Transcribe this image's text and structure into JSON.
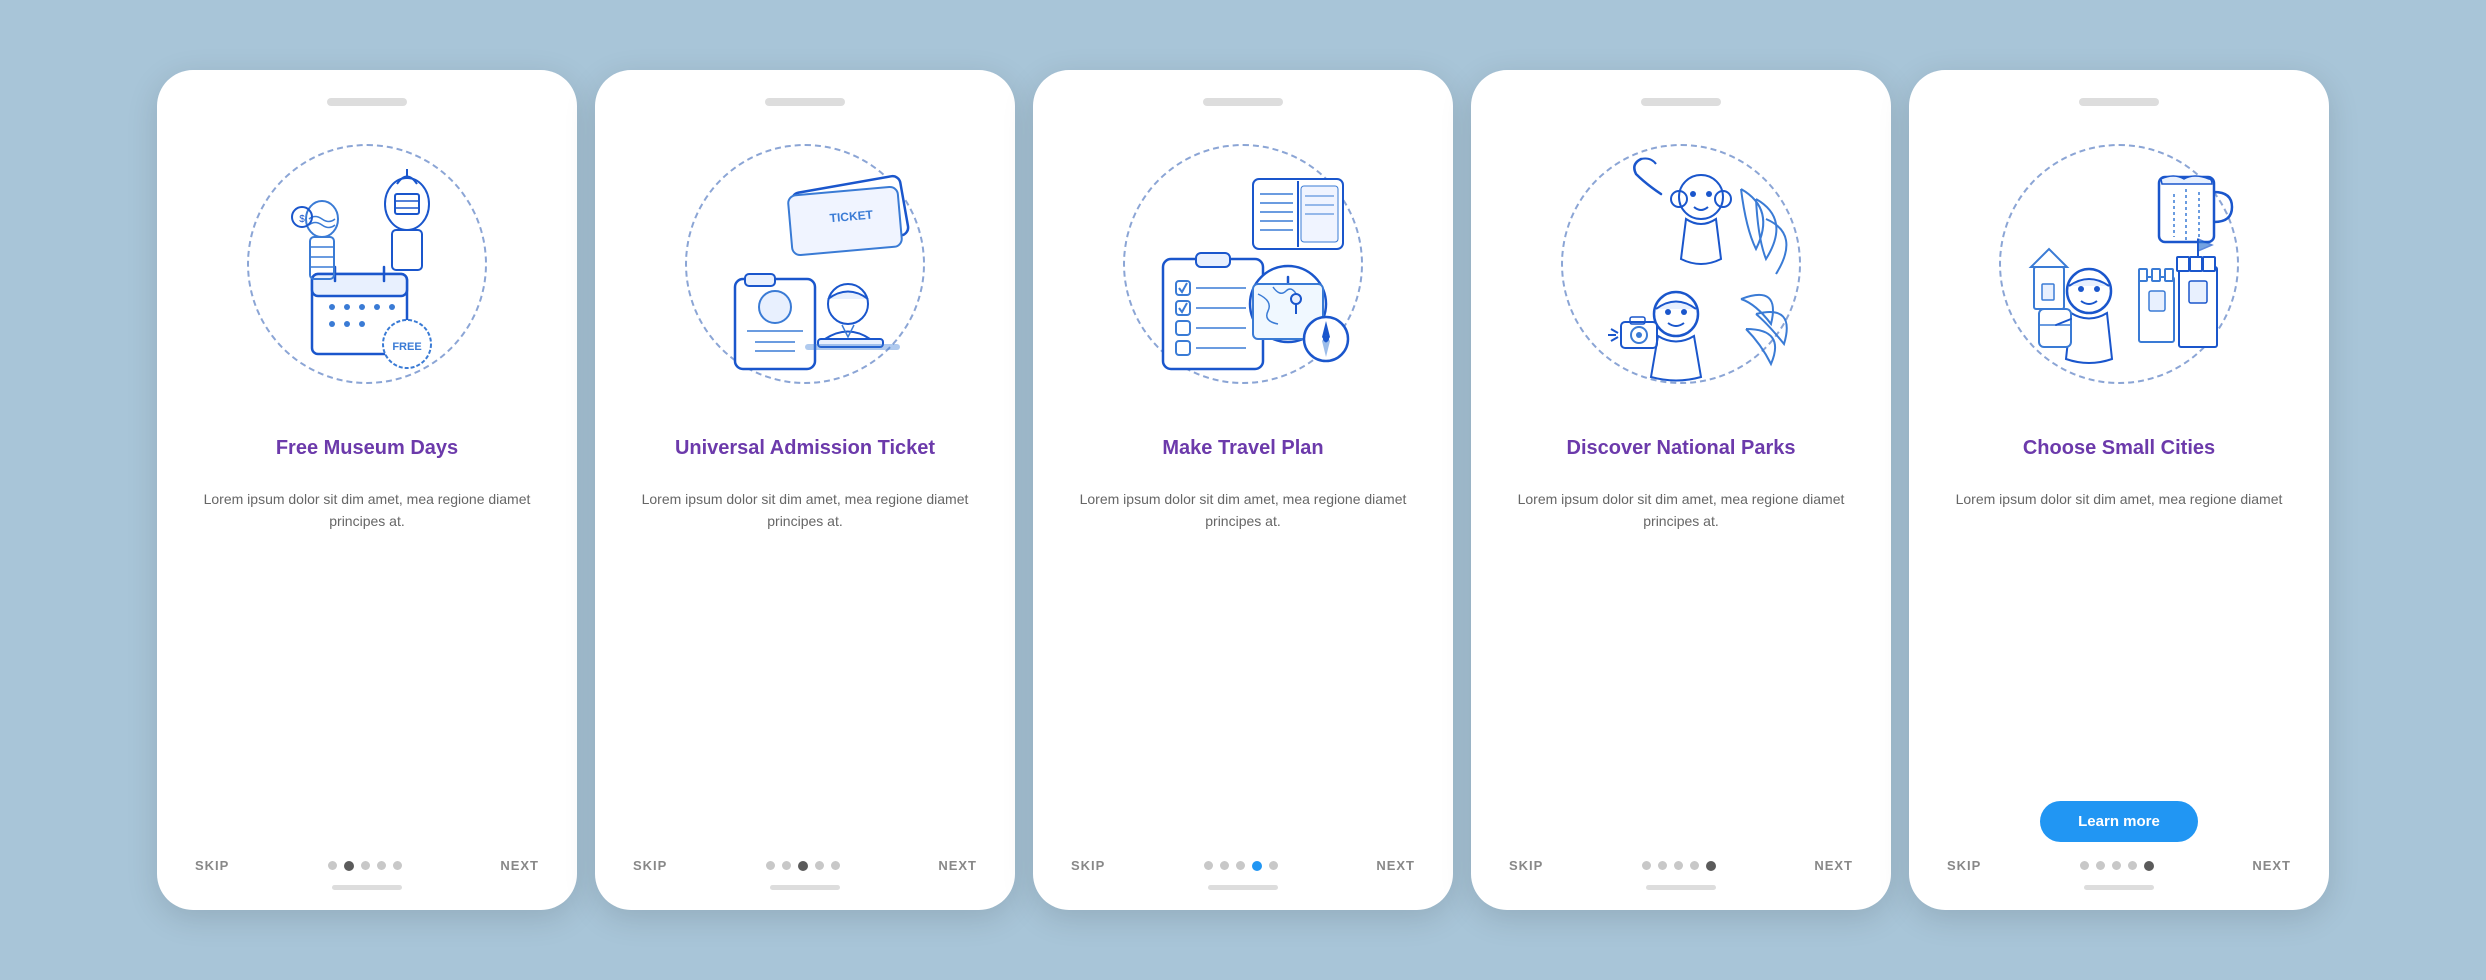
{
  "screens": [
    {
      "id": "screen-1",
      "title": "Free Museum Days",
      "description": "Lorem ipsum dolor sit dim amet, mea regione diamet principes at.",
      "skip_label": "SKIP",
      "next_label": "NEXT",
      "dots": [
        false,
        true,
        false,
        false,
        false
      ],
      "active_dot": 1,
      "show_learn_more": false,
      "illustration": "museum"
    },
    {
      "id": "screen-2",
      "title": "Universal\nAdmission Ticket",
      "description": "Lorem ipsum dolor sit dim amet, mea regione diamet principes at.",
      "skip_label": "SKIP",
      "next_label": "NEXT",
      "dots": [
        false,
        false,
        true,
        false,
        false
      ],
      "active_dot": 2,
      "show_learn_more": false,
      "illustration": "ticket"
    },
    {
      "id": "screen-3",
      "title": "Make Travel Plan",
      "description": "Lorem ipsum dolor sit dim amet, mea regione diamet principes at.",
      "skip_label": "SKIP",
      "next_label": "NEXT",
      "dots": [
        false,
        false,
        false,
        true,
        false
      ],
      "active_dot": 3,
      "show_learn_more": false,
      "illustration": "travel"
    },
    {
      "id": "screen-4",
      "title": "Discover\nNational Parks",
      "description": "Lorem ipsum dolor sit dim amet, mea regione diamet principes at.",
      "skip_label": "SKIP",
      "next_label": "NEXT",
      "dots": [
        false,
        false,
        false,
        false,
        true
      ],
      "active_dot": 4,
      "show_learn_more": false,
      "illustration": "parks"
    },
    {
      "id": "screen-5",
      "title": "Choose\nSmall Cities",
      "description": "Lorem ipsum dolor sit dim amet, mea regione diamet",
      "skip_label": "SKIP",
      "next_label": "NEXT",
      "dots": [
        false,
        false,
        false,
        false,
        false
      ],
      "active_dot": -1,
      "show_learn_more": true,
      "learn_more_label": "Learn more",
      "illustration": "cities"
    }
  ]
}
